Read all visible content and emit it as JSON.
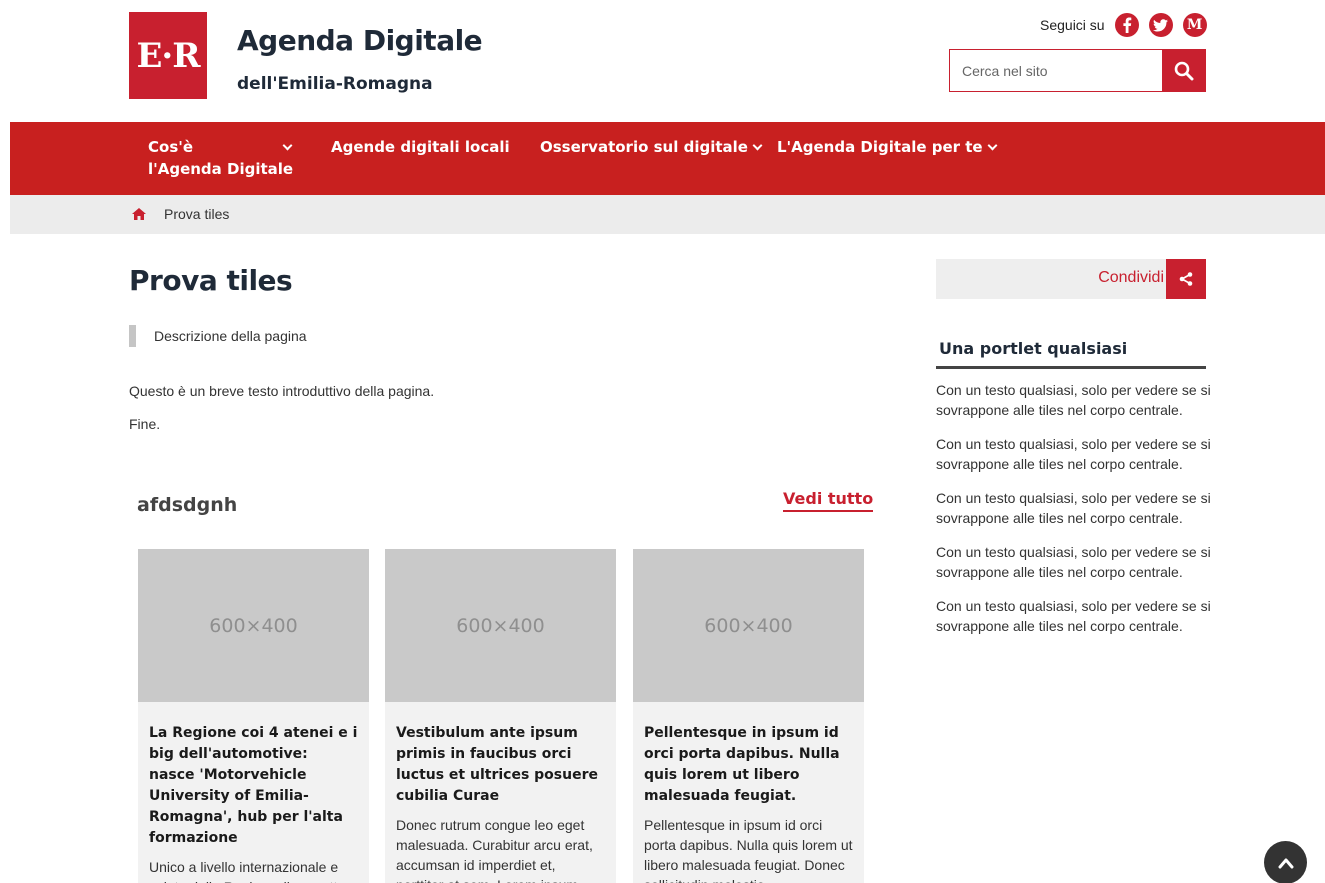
{
  "header": {
    "logo_text": "E·R",
    "title": "Agenda Digitale",
    "subtitle": "dell'Emilia-Romagna",
    "follow_label": "Seguici su",
    "social": [
      {
        "name": "facebook",
        "glyph": "f"
      },
      {
        "name": "twitter",
        "glyph": "t"
      },
      {
        "name": "medium",
        "glyph": "M"
      }
    ],
    "search_placeholder": "Cerca nel sito",
    "accent_color": "#c8202f"
  },
  "nav": {
    "items": [
      {
        "label_line1": "Cos'è",
        "label_line2": "l'Agenda Digitale",
        "has_dropdown": true
      },
      {
        "label": "Agende digitali locali",
        "has_dropdown": false
      },
      {
        "label": "Osservatorio sul digitale",
        "has_dropdown": true
      },
      {
        "label": "L'Agenda Digitale per te",
        "has_dropdown": true
      }
    ]
  },
  "breadcrumb": {
    "current": "Prova tiles"
  },
  "main": {
    "title": "Prova tiles",
    "description": "Descrizione della pagina",
    "intro": "Questo è un breve testo introduttivo della pagina.",
    "fine": "Fine.",
    "section": {
      "title": "afdsdgnh",
      "see_all": "Vedi tutto",
      "tiles": [
        {
          "image_label": "600×400",
          "title": "La Regione coi 4 atenei e i big dell'automotive: nasce 'Motorvehicle University of Emilia-Romagna', hub per l'alta formazione",
          "text": "Unico a livello internazionale e voluto dalla Regione, il progetto"
        },
        {
          "image_label": "600×400",
          "title": "Vestibulum ante ipsum primis in faucibus orci luctus et ultrices posuere cubilia Curae",
          "text": "Donec rutrum congue leo eget malesuada. Curabitur arcu erat, accumsan id imperdiet et, porttitor at sem. Lorem ipsum..."
        },
        {
          "image_label": "600×400",
          "title": "Pellentesque in ipsum id orci porta dapibus. Nulla quis lorem ut libero malesuada feugiat.",
          "text": "Pellentesque in ipsum id orci porta dapibus. Nulla quis lorem ut libero malesuada feugiat. Donec sollicitudin molestie..."
        }
      ]
    }
  },
  "sidebar": {
    "share_label": "Condividi",
    "portlet_title": "Una portlet qualsiasi",
    "portlet_items": [
      "Con un testo qualsiasi, solo per vedere se si sovrappone alle tiles nel corpo centrale.",
      "Con un testo qualsiasi, solo per vedere se si sovrappone alle tiles nel corpo centrale.",
      "Con un testo qualsiasi, solo per vedere se si sovrappone alle tiles nel corpo centrale.",
      "Con un testo qualsiasi, solo per vedere se si sovrappone alle tiles nel corpo centrale.",
      "Con un testo qualsiasi, solo per vedere se si sovrappone alle tiles nel corpo centrale."
    ]
  }
}
